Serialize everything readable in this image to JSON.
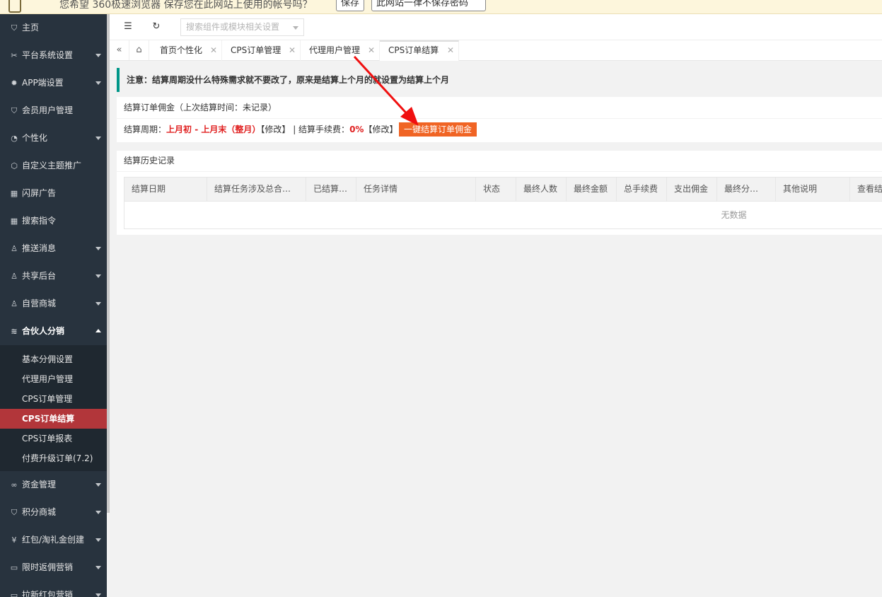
{
  "topbar": {
    "message": "您希望 360极速浏览器 保存您在此网站上使用的帐号吗？",
    "save_label": "保存",
    "never_label": "此网站一律不保存密码"
  },
  "sidebar": {
    "items": [
      {
        "label": "主页",
        "icon": "shield-check-icon"
      },
      {
        "label": "平台系统设置",
        "icon": "tools-icon"
      },
      {
        "label": "APP端设置",
        "icon": "gear-icon"
      },
      {
        "label": "会员用户管理",
        "icon": "shield-check-icon"
      },
      {
        "label": "个性化",
        "icon": "palette-icon"
      },
      {
        "label": "自定义主题推广",
        "icon": "box-icon"
      },
      {
        "label": "闪屏广告",
        "icon": "grid-icon"
      },
      {
        "label": "搜索指令",
        "icon": "grid-icon"
      },
      {
        "label": "推送消息",
        "icon": "user-icon"
      },
      {
        "label": "共享后台",
        "icon": "user-icon"
      },
      {
        "label": "自营商城",
        "icon": "user-icon"
      },
      {
        "label": "合伙人分销",
        "icon": "layers-icon"
      }
    ],
    "sub_items": [
      {
        "label": "基本分佣设置"
      },
      {
        "label": "代理用户管理"
      },
      {
        "label": "CPS订单管理"
      },
      {
        "label": "CPS订单结算"
      },
      {
        "label": "CPS订单报表"
      },
      {
        "label": "付费升级订单(7.2)"
      }
    ],
    "items_after": [
      {
        "label": "资金管理",
        "icon": "link-icon"
      },
      {
        "label": "积分商城",
        "icon": "shield-check-icon"
      },
      {
        "label": "红包/淘礼金创建",
        "icon": "yen-icon"
      },
      {
        "label": "限时返佣营销",
        "icon": "window-icon"
      },
      {
        "label": "拉新红包营销",
        "icon": "window-icon"
      }
    ]
  },
  "toolbar": {
    "search_placeholder": "搜索组件或模块相关设置"
  },
  "tabs": [
    {
      "label": "首页个性化"
    },
    {
      "label": "CPS订单管理"
    },
    {
      "label": "代理用户管理"
    },
    {
      "label": "CPS订单结算"
    }
  ],
  "notice": {
    "text": "注意：结算周期没什么特殊需求就不要改了，原来是结算上个月的就设置为结算上个月"
  },
  "settle": {
    "title": "结算订单佣金（上次结算时间：未记录）",
    "period_label": "结算周期：",
    "period_value": "上月初 - 上月末（整月）",
    "modify1": "【修改】",
    "separator": " | ",
    "fee_label": "结算手续费：",
    "fee_value": "0%",
    "modify2": "【修改】",
    "button_label": "一键结算订单佣金"
  },
  "history": {
    "title": "结算历史记录",
    "columns": [
      "结算日期",
      "结算任务涉及总合…",
      "已结算…",
      "任务详情",
      "状态",
      "最终人数",
      "最终金额",
      "总手续费",
      "支出佣金",
      "最终分…",
      "其他说明",
      "查看结"
    ],
    "empty_text": "无数据"
  },
  "colors": {
    "sidebar_bg": "#28333e",
    "active_item": "#b2363a",
    "accent_green": "#009688",
    "button_orange": "#f06424",
    "highlight_red": "#e02020"
  }
}
